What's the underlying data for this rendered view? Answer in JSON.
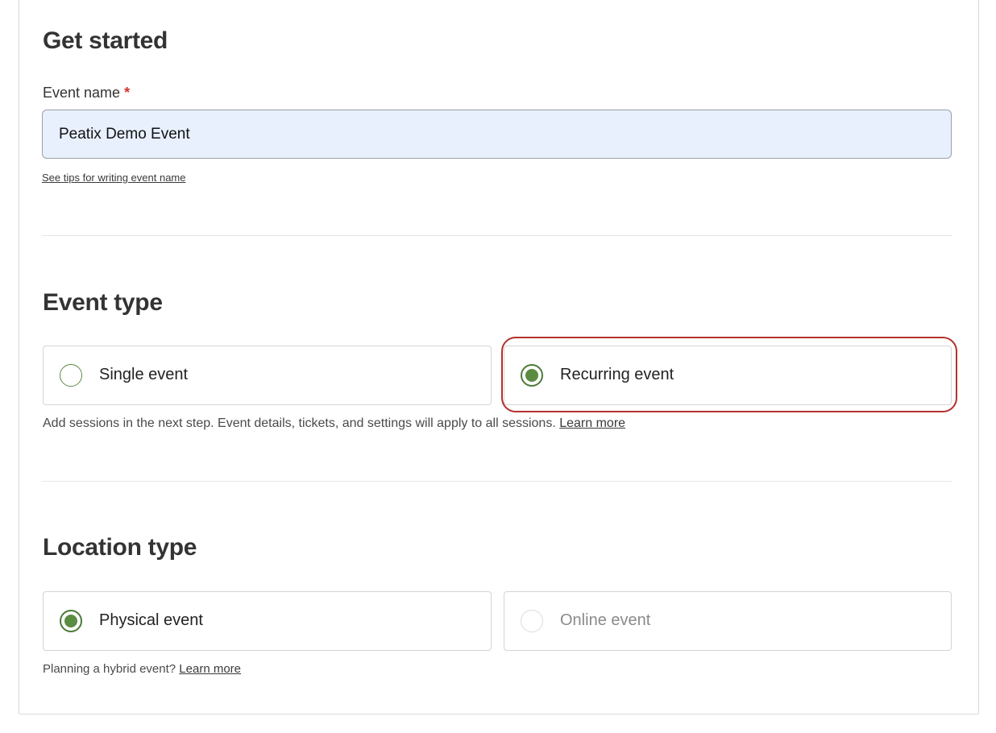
{
  "get_started": {
    "title": "Get started",
    "event_name_label": "Event name",
    "required_mark": "*",
    "event_name_value": "Peatix Demo Event",
    "tips_link": "See tips for writing event name"
  },
  "event_type": {
    "title": "Event type",
    "options": [
      {
        "label": "Single event",
        "selected": false
      },
      {
        "label": "Recurring event",
        "selected": true
      }
    ],
    "helper_text": "Add sessions in the next step. Event details, tickets, and settings will apply to all sessions.",
    "learn_more": "Learn more"
  },
  "location_type": {
    "title": "Location type",
    "options": [
      {
        "label": "Physical event",
        "selected": true
      },
      {
        "label": "Online event",
        "selected": false,
        "disabled": true
      }
    ],
    "helper_text": "Planning a hybrid event?",
    "learn_more": "Learn more"
  },
  "colors": {
    "radio_selected": "#5a8c42",
    "highlight": "#b3322e",
    "input_bg": "#e8f0fe"
  }
}
